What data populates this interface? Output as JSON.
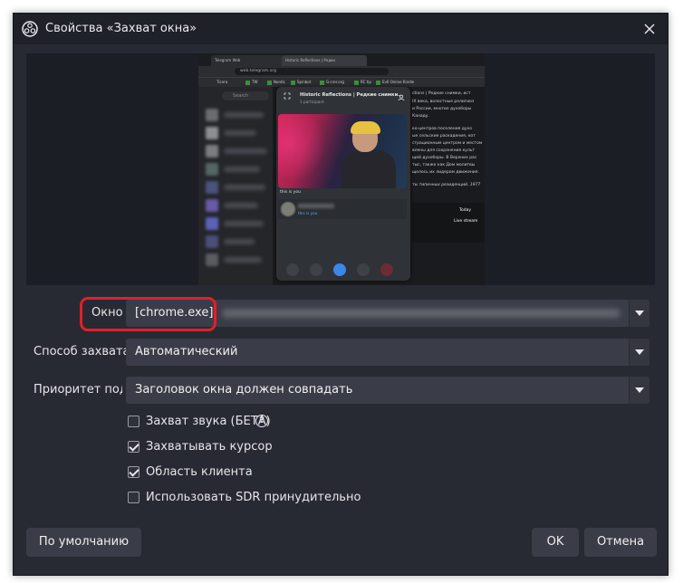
{
  "window": {
    "title": "Свойства «Захват окна»",
    "icon": "obs-icon",
    "close_icon": "close-icon"
  },
  "preview": {
    "browser": {
      "tabs": [
        {
          "label": "Telegram Web"
        },
        {
          "label": "Historic Reflections | Редки"
        }
      ],
      "url": "web.telegram.org",
      "bookmarks": [
        "Ticera",
        "TW",
        "Nordic",
        "Spinbot",
        "G-crer.org",
        "RC tip",
        "Ev0 Online Kindle"
      ]
    },
    "telegram": {
      "search_placeholder": "Search",
      "call_title": "Historic Reflections | Редкие снимки...",
      "call_subtitle": "1 participant",
      "self_label": "this is you",
      "tile_sub": "this is you",
      "content_lines": [
        "ctions | Редкие снимки, ист",
        "IX века, волостные религиоз",
        "и России, многие духоборы",
        "Канаду.",
        "ко-центров поселения духо",
        "ые сельские раскадения, кот",
        "страционным центром и местом",
        "влены для сохранения культ",
        "щей духоборы. В Верхних рас",
        "тыс, также как Дом молитвы",
        "щелось их лидером движения.",
        "ты типичных резиденций. 1977",
        "Today",
        "Live stream"
      ]
    }
  },
  "fields": {
    "window": {
      "label": "Окно",
      "value": "[chrome.exe]:"
    },
    "capture_method": {
      "label": "Способ захвата",
      "value": "Автоматический"
    },
    "priority": {
      "label": "Приоритет под",
      "value": "Заголовок окна должен совпадать"
    }
  },
  "checkboxes": [
    {
      "label": "Захват звука (БЕТА)",
      "checked": false
    },
    {
      "label": "Захватывать курсор",
      "checked": true
    },
    {
      "label": "Область клиента",
      "checked": true
    },
    {
      "label": "Использовать SDR принудительно",
      "checked": false
    }
  ],
  "buttons": {
    "defaults": "По умолчанию",
    "ok": "OK",
    "cancel": "Отмена"
  },
  "colors": {
    "background": "#272a33",
    "highlight": "#e0202a",
    "accent_blue": "#3b86e8"
  }
}
